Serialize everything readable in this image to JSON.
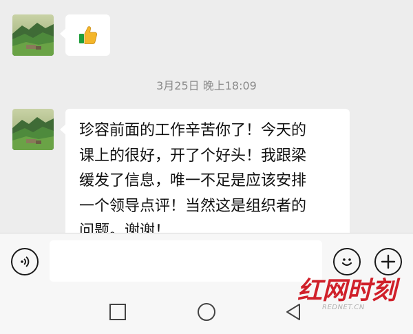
{
  "messages": [
    {
      "type": "emoji",
      "emoji": "👍",
      "emoji_name": "thumbs-up-icon"
    },
    {
      "type": "text",
      "lines": [
        "珍容前面的工作辛苦你了！今天的",
        "课上的很好，开了个好头！我跟梁",
        "缓发了信息，唯一不足是应该安排",
        "一个领导点评！当然这是组织者的",
        "问题。谢谢！"
      ]
    }
  ],
  "timestamp": "3月25日 晚上18:09",
  "input_bar": {
    "voice_icon": "voice-icon",
    "emoji_icon": "smiley-icon",
    "plus_icon": "plus-icon",
    "input_value": ""
  },
  "nav_bar": {
    "back_icon": "triangle-back-icon",
    "home_icon": "circle-home-icon",
    "recent_icon": "square-recent-icon"
  },
  "watermark": {
    "logo_text": "红网时刻",
    "url": "REDNET.CN",
    "color": "#d0202a"
  }
}
